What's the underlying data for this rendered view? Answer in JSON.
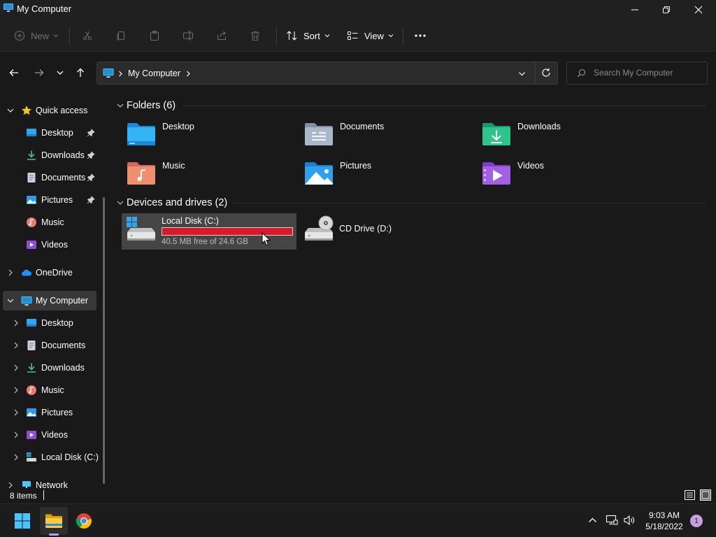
{
  "window": {
    "title": "My Computer"
  },
  "toolbar": {
    "new_label": "New",
    "sort_label": "Sort",
    "view_label": "View"
  },
  "address": {
    "crumb": "My Computer",
    "search_placeholder": "Search My Computer"
  },
  "sidebar": {
    "quick_access": "Quick access",
    "quick_items": [
      {
        "label": "Desktop",
        "pinned": true,
        "icon": "desktop-icon"
      },
      {
        "label": "Downloads",
        "pinned": true,
        "icon": "downloads-icon"
      },
      {
        "label": "Documents",
        "pinned": true,
        "icon": "documents-icon"
      },
      {
        "label": "Pictures",
        "pinned": true,
        "icon": "pictures-icon"
      },
      {
        "label": "Music",
        "pinned": false,
        "icon": "music-icon"
      },
      {
        "label": "Videos",
        "pinned": false,
        "icon": "videos-icon"
      }
    ],
    "onedrive": "OneDrive",
    "my_computer": "My Computer",
    "computer_items": [
      {
        "label": "Desktop",
        "icon": "desktop-icon"
      },
      {
        "label": "Documents",
        "icon": "documents-icon"
      },
      {
        "label": "Downloads",
        "icon": "downloads-icon"
      },
      {
        "label": "Music",
        "icon": "music-icon"
      },
      {
        "label": "Pictures",
        "icon": "pictures-icon"
      },
      {
        "label": "Videos",
        "icon": "videos-icon"
      },
      {
        "label": "Local Disk (C:)",
        "icon": "drive-icon"
      }
    ],
    "network": "Network"
  },
  "content": {
    "folders_header": "Folders (6)",
    "folders": [
      {
        "label": "Desktop",
        "icon": "desktop-folder-icon"
      },
      {
        "label": "Documents",
        "icon": "documents-folder-icon"
      },
      {
        "label": "Downloads",
        "icon": "downloads-folder-icon"
      },
      {
        "label": "Music",
        "icon": "music-folder-icon"
      },
      {
        "label": "Pictures",
        "icon": "pictures-folder-icon"
      },
      {
        "label": "Videos",
        "icon": "videos-folder-icon"
      }
    ],
    "drives_header": "Devices and drives (2)",
    "local_disk": {
      "label": "Local Disk (C:)",
      "free_text": "40.5 MB free of 24.6 GB",
      "used_fraction": 0.998
    },
    "cd_drive": {
      "label": "CD Drive (D:)"
    }
  },
  "status": {
    "item_count": "8 items"
  },
  "taskbar": {
    "time": "9:03 AM",
    "date": "5/18/2022",
    "notifications": "1"
  },
  "colors": {
    "accent_blue": "#4cc2ff",
    "disk_full_red": "#d61a2c",
    "background": "#191919"
  }
}
